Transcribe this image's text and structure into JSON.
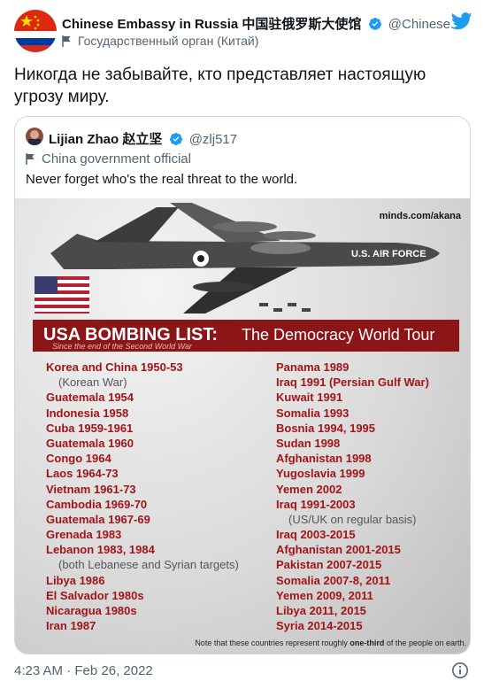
{
  "tweet": {
    "author_name": "Chinese Embassy in Russia 中国驻俄罗斯大使馆",
    "author_handle": "@Chinese...",
    "author_label": "Государственный орган (Китай)",
    "text": "Никогда не забывайте, кто представляет настоящую угрозу миру.",
    "timestamp": "4:23 AM · Feb 26, 2022"
  },
  "quoted_tweet": {
    "author_name": "Lijian Zhao 赵立坚",
    "author_handle": "@zlj517",
    "author_label": "China government official",
    "text": "Never forget who's the real threat to the world.",
    "image": {
      "watermark": "minds.com/akana",
      "plane_text": "U.S. AIR FORCE",
      "title": "USA BOMBING LIST:",
      "subtitle": "The Democracy World Tour",
      "small_caption": "Since the end of the Second World War",
      "left_list": [
        "Korea and China 1950-53",
        "(Korean War)",
        "Guatemala 1954",
        "Indonesia 1958",
        "Cuba 1959-1961",
        "Guatemala 1960",
        "Congo 1964",
        "Laos 1964-73",
        "Vietnam 1961-73",
        "Cambodia 1969-70",
        "Guatemala 1967-69",
        "Grenada 1983",
        "Lebanon 1983, 1984",
        "(both Lebanese and Syrian targets)",
        "Libya 1986",
        "El Salvador 1980s",
        "Nicaragua 1980s",
        "Iran 1987"
      ],
      "right_list": [
        "Panama 1989",
        "Iraq 1991 (Persian Gulf War)",
        "Kuwait 1991",
        "Somalia 1993",
        "Bosnia 1994, 1995",
        "Sudan 1998",
        "Afghanistan 1998",
        "Yugoslavia 1999",
        "Yemen 2002",
        "Iraq 1991-2003",
        "(US/UK on regular basis)",
        "Iraq 2003-2015",
        "Afghanistan 2001-2015",
        "Pakistan 2007-2015",
        "Somalia 2007-8, 2011",
        "Yemen 2009, 2011",
        "Libya 2011, 2015",
        "Syria 2014-2015"
      ],
      "note_prefix": "Note that these countries represent roughly ",
      "note_bold": "one-third",
      "note_suffix": " of the people on earth."
    }
  },
  "icons": {
    "verified": "verified-badge-icon",
    "label": "flag-icon",
    "brand": "twitter-bird-icon",
    "info": "info-icon"
  },
  "colors": {
    "twitter_blue": "#1d9bf0",
    "banner_red": "#8c1518",
    "list_red": "#a21417"
  }
}
